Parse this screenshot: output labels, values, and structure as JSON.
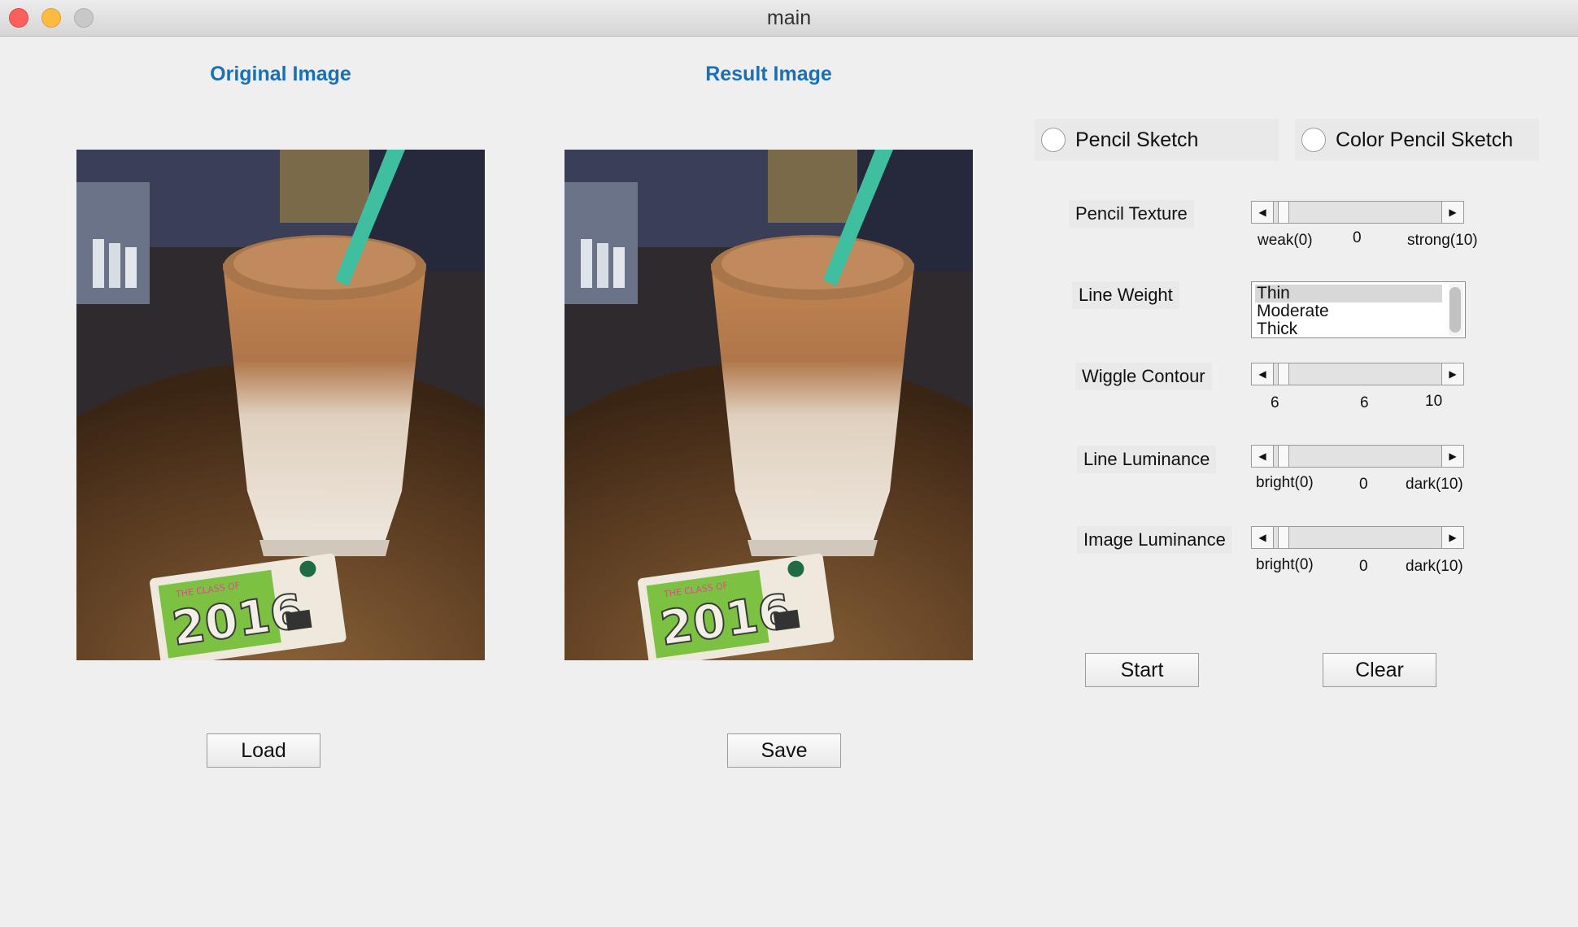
{
  "window": {
    "title": "main"
  },
  "original": {
    "title": "Original Image",
    "load_label": "Load"
  },
  "result": {
    "title": "Result Image",
    "save_label": "Save"
  },
  "modes": {
    "pencil_sketch": "Pencil Sketch",
    "color_pencil_sketch": "Color Pencil Sketch"
  },
  "controls": {
    "pencil_texture": {
      "label": "Pencil Texture",
      "min_label": "weak(0)",
      "value": "0",
      "max_label": "strong(10)"
    },
    "line_weight": {
      "label": "Line Weight",
      "options": [
        "Thin",
        "Moderate",
        "Thick"
      ],
      "selected": "Thin"
    },
    "wiggle_contour": {
      "label": "Wiggle Contour",
      "min_label": "6",
      "value": "6",
      "max_label": "10"
    },
    "line_luminance": {
      "label": "Line Luminance",
      "min_label": "bright(0)",
      "value": "0",
      "max_label": "dark(10)"
    },
    "image_luminance": {
      "label": "Image Luminance",
      "min_label": "bright(0)",
      "value": "0",
      "max_label": "dark(10)"
    }
  },
  "actions": {
    "start_label": "Start",
    "clear_label": "Clear"
  },
  "photo": {
    "card_text": "2016",
    "card_small_text": "THE CLASS OF"
  },
  "colors": {
    "title_blue": "#1a70b8",
    "straw": "#3fbf9f",
    "card_green": "#7dc142"
  }
}
